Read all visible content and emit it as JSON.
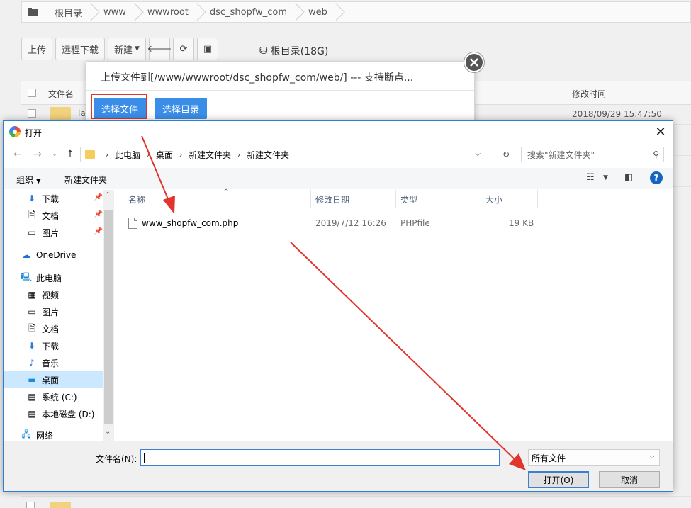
{
  "breadcrumb": {
    "items": [
      "根目录",
      "www",
      "wwwroot",
      "dsc_shopfw_com",
      "web"
    ]
  },
  "toolbar": {
    "upload": "上传",
    "remote_download": "远程下载",
    "new": "新建",
    "disk": "根目录(18G)"
  },
  "file_table": {
    "col_name": "文件名",
    "col_mtime": "修改时间",
    "row1_name": "la",
    "row1_date": "2018/09/29 15:47:50"
  },
  "upload_dialog": {
    "title": "上传文件到[/www/wwwroot/dsc_shopfw_com/web/] --- 支持断点...",
    "select_file": "选择文件",
    "select_dir": "选择目录"
  },
  "open_dialog": {
    "title": "打开",
    "address": [
      "此电脑",
      "桌面",
      "新建文件夹",
      "新建文件夹"
    ],
    "search_placeholder": "搜索\"新建文件夹\"",
    "organize": "组织",
    "new_folder": "新建文件夹",
    "nav": [
      {
        "label": "下载",
        "icon": "download-icon",
        "pinned": true
      },
      {
        "label": "文档",
        "icon": "document-icon",
        "pinned": true
      },
      {
        "label": "图片",
        "icon": "picture-icon",
        "pinned": true
      },
      {
        "label": "OneDrive",
        "icon": "cloud-icon",
        "pinned": false
      },
      {
        "label": "此电脑",
        "icon": "computer-icon",
        "pinned": false
      },
      {
        "label": "视频",
        "icon": "video-icon",
        "pinned": false
      },
      {
        "label": "图片",
        "icon": "picture-icon",
        "pinned": false
      },
      {
        "label": "文档",
        "icon": "document-icon",
        "pinned": false
      },
      {
        "label": "下载",
        "icon": "download-icon",
        "pinned": false
      },
      {
        "label": "音乐",
        "icon": "music-icon",
        "pinned": false
      },
      {
        "label": "桌面",
        "icon": "desktop-icon",
        "pinned": false,
        "selected": true
      },
      {
        "label": "系统 (C:)",
        "icon": "system-drive-icon",
        "pinned": false
      },
      {
        "label": "本地磁盘 (D:)",
        "icon": "drive-icon",
        "pinned": false
      },
      {
        "label": "网络",
        "icon": "network-icon",
        "pinned": false
      }
    ],
    "columns": {
      "name": "名称",
      "date": "修改日期",
      "type": "类型",
      "size": "大小"
    },
    "files": [
      {
        "name": "www_shopfw_com.php",
        "date": "2019/7/12 16:26",
        "type": "PHPfile",
        "size": "19 KB"
      }
    ],
    "filename_label": "文件名(N):",
    "filename_value": "",
    "filetype": "所有文件",
    "open_button": "打开(O)",
    "cancel_button": "取消"
  },
  "colors": {
    "accent_blue": "#3b8ee8",
    "annotation_red": "#e2332c",
    "selection": "#cce8ff"
  }
}
